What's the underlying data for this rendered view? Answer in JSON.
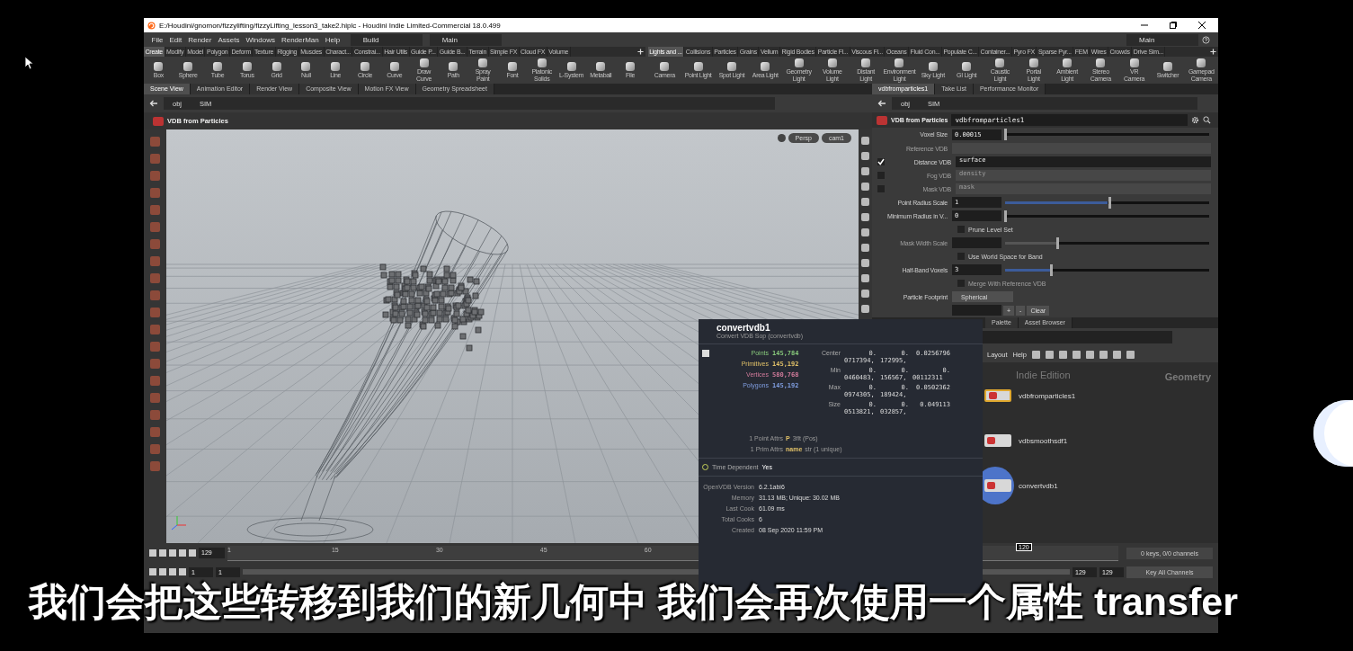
{
  "window": {
    "title": "E:/Houdini/gnomon/fizzylifting/fizzyLifting_lesson3_take2.hiplc - Houdini Indie Limited-Commercial 18.0.499"
  },
  "menu": [
    "File",
    "Edit",
    "Render",
    "Assets",
    "Windows",
    "RenderMan",
    "Help"
  ],
  "desktops": [
    {
      "label": "Build"
    },
    {
      "label": "Main"
    }
  ],
  "desktop_right": "Main",
  "shelves": [
    {
      "tabs": [
        {
          "label": "Create",
          "selected": true
        },
        {
          "label": "Modify",
          "selected": false
        },
        {
          "label": "Model",
          "selected": false
        },
        {
          "label": "Polygon",
          "selected": false
        },
        {
          "label": "Deform",
          "selected": false
        },
        {
          "label": "Texture",
          "selected": false
        },
        {
          "label": "Rigging",
          "selected": false
        },
        {
          "label": "Muscles",
          "selected": false
        },
        {
          "label": "Charact...",
          "selected": false
        },
        {
          "label": "Constrai...",
          "selected": false
        },
        {
          "label": "Hair Utils",
          "selected": false
        },
        {
          "label": "Guide P...",
          "selected": false
        },
        {
          "label": "Guide B...",
          "selected": false
        },
        {
          "label": "Terrain",
          "selected": false
        },
        {
          "label": "Simple FX",
          "selected": false
        },
        {
          "label": "Cloud FX",
          "selected": false
        },
        {
          "label": "Volume",
          "selected": false
        }
      ],
      "tools": [
        "Box",
        "Sphere",
        "Tube",
        "Torus",
        "Grid",
        "Null",
        "Line",
        "Circle",
        "Curve",
        "Draw Curve",
        "Path",
        "Spray Paint",
        "Font",
        "Platonic Solids",
        "L-System",
        "Metaball",
        "File"
      ]
    },
    {
      "tabs": [
        {
          "label": "Lights and ...",
          "selected": true
        },
        {
          "label": "Collisions",
          "selected": false
        },
        {
          "label": "Particles",
          "selected": false
        },
        {
          "label": "Grains",
          "selected": false
        },
        {
          "label": "Vellum",
          "selected": false
        },
        {
          "label": "Rigid Bodies",
          "selected": false
        },
        {
          "label": "Particle Fl...",
          "selected": false
        },
        {
          "label": "Viscous Fl...",
          "selected": false
        },
        {
          "label": "Oceans",
          "selected": false
        },
        {
          "label": "Fluid Con...",
          "selected": false
        },
        {
          "label": "Populate C...",
          "selected": false
        },
        {
          "label": "Container...",
          "selected": false
        },
        {
          "label": "Pyro FX",
          "selected": false
        },
        {
          "label": "Sparse Pyr...",
          "selected": false
        },
        {
          "label": "FEM",
          "selected": false
        },
        {
          "label": "Wires",
          "selected": false
        },
        {
          "label": "Crowds",
          "selected": false
        },
        {
          "label": "Drive Sim...",
          "selected": false
        }
      ],
      "tools": [
        "Camera",
        "Point Light",
        "Spot Light",
        "Area Light",
        "Geometry Light",
        "Volume Light",
        "Distant Light",
        "Environment Light",
        "Sky Light",
        "GI Light",
        "Caustic Light",
        "Portal Light",
        "Ambient Light",
        "Stereo Camera",
        "VR Camera",
        "Switcher",
        "Gamepad Camera"
      ]
    }
  ],
  "pane_tabs_left": [
    {
      "label": "Scene View",
      "selected": true
    },
    {
      "label": "Animation Editor",
      "selected": false
    },
    {
      "label": "Render View",
      "selected": false
    },
    {
      "label": "Composite View",
      "selected": false
    },
    {
      "label": "Motion FX View",
      "selected": false
    },
    {
      "label": "Geometry Spreadsheet",
      "selected": false
    }
  ],
  "pane_tabs_right": [
    {
      "label": "vdbfromparticles1",
      "selected": true
    },
    {
      "label": "Take List",
      "selected": false
    },
    {
      "label": "Performance Monitor",
      "selected": false
    }
  ],
  "path_left": [
    "obj",
    "SIM"
  ],
  "path_right": [
    "obj",
    "SIM"
  ],
  "viewport": {
    "operation": "VDB from Particles",
    "view_buttons": [
      "Persp",
      "cam1"
    ]
  },
  "parameters": {
    "node_type": "VDB from Particles",
    "node_name": "vdbfromparticles1",
    "rows": [
      {
        "kind": "slider",
        "label": "Voxel Size",
        "value": "0.00015",
        "level": 0,
        "disabled": false
      },
      {
        "kind": "menu_field",
        "label": "Reference VDB",
        "disabled": true
      },
      {
        "kind": "toggle_field",
        "label": "Distance VDB",
        "value": "surface",
        "checked": true,
        "disabled": false
      },
      {
        "kind": "toggle_field",
        "label": "Fog VDB",
        "value": "density",
        "checked": false,
        "disabled": true
      },
      {
        "kind": "toggle_field",
        "label": "Mask VDB",
        "value": "mask",
        "checked": false,
        "disabled": true
      },
      {
        "kind": "slider",
        "label": "Point Radius Scale",
        "value": "1",
        "level": 0.5,
        "disabled": false
      },
      {
        "kind": "slider",
        "label": "Minimum Radius in V...",
        "value": "0",
        "level": 0,
        "disabled": false
      },
      {
        "kind": "checkbox",
        "label": "Prune Level Set",
        "checked": false,
        "disabled": false
      },
      {
        "kind": "slider",
        "label": "Mask Width Scale",
        "level": 0.25,
        "disabled": true
      },
      {
        "kind": "checkbox",
        "label": "Use World Space for Band",
        "checked": false,
        "disabled": false
      },
      {
        "kind": "slider",
        "label": "Half-Band Voxels",
        "value": "3",
        "level": 0.22,
        "disabled": false
      },
      {
        "kind": "checkbox",
        "label": "Merge With Reference VDB",
        "checked": false,
        "disabled": true
      },
      {
        "kind": "menu",
        "label": "Particle Footprint",
        "value": "Spherical",
        "disabled": false
      },
      {
        "kind": "buttons",
        "buttons": [
          "+",
          "-",
          "Clear"
        ]
      }
    ]
  },
  "network": {
    "tabs": [
      {
        "label": "Palette",
        "selected": false
      },
      {
        "label": "Asset Browser",
        "selected": false
      }
    ],
    "toolbar": [
      "Layout",
      "Help"
    ],
    "edition_label": "Indie Edition",
    "context_label": "Geometry",
    "nodes": [
      {
        "name": "vdbfromparticles1",
        "selected": true,
        "display": false
      },
      {
        "name": "vdbsmoothsdf1",
        "selected": false,
        "display": false
      },
      {
        "name": "convertvdb1",
        "selected": false,
        "display": true
      }
    ]
  },
  "timeline": {
    "frame": "129",
    "ticks": [
      "1",
      "15",
      "30",
      "45",
      "60"
    ],
    "marker": "120",
    "start": "1",
    "start2": "1",
    "end": "129",
    "end2": "129",
    "keys": "0 keys, 0/0 channels",
    "key_all": "Key All Channels"
  },
  "info_popup": {
    "title": "convertvdb1",
    "subtitle": "Convert VDB Sop (convertvdb)",
    "stats": [
      {
        "label": "Points",
        "value": "145,784",
        "color": "#86c77a"
      },
      {
        "label": "Primitives",
        "value": "145,192",
        "color": "#e0c068"
      },
      {
        "label": "Vertices",
        "value": "580,768",
        "color": "#d07a9a"
      },
      {
        "label": "Polygons",
        "value": "145,192",
        "color": "#7f9de0"
      }
    ],
    "bounds": [
      {
        "label": "Center",
        "cells": [
          "0.",
          "0.",
          "0.0256796",
          "0717394,",
          "172995,"
        ]
      },
      {
        "label": "Min",
        "cells": [
          "0.",
          "0.",
          "0.",
          "0460483,",
          "156567,",
          "00112311"
        ]
      },
      {
        "label": "Max",
        "cells": [
          "0.",
          "0.",
          "0.0502362",
          "0974305,",
          "189424,"
        ]
      },
      {
        "label": "Size",
        "cells": [
          "0.",
          "0.",
          "0.049113",
          "0513821,",
          "032857,"
        ]
      }
    ],
    "attributes": [
      {
        "label": "1 Point Attrs",
        "name": "P",
        "detail": "3flt (Pos)"
      },
      {
        "label": "1 Prim Attrs",
        "name": "name",
        "detail": "str (1 unique)"
      }
    ],
    "time_dependent": {
      "label": "Time Dependent",
      "value": "Yes"
    },
    "info": [
      {
        "label": "OpenVDB Version",
        "value": "6.2.1abi6"
      },
      {
        "label": "Memory",
        "value": "31.13 MB; Unique: 30.02 MB"
      },
      {
        "label": "Last Cook",
        "value": "61.09 ms"
      },
      {
        "label": "Total Cooks",
        "value": "6"
      },
      {
        "label": "Created",
        "value": "08 Sep 2020 11:59 PM"
      }
    ]
  },
  "subtitle": "我们会把这些转移到我们的新几何中 我们会再次使用一个属性 transfer"
}
